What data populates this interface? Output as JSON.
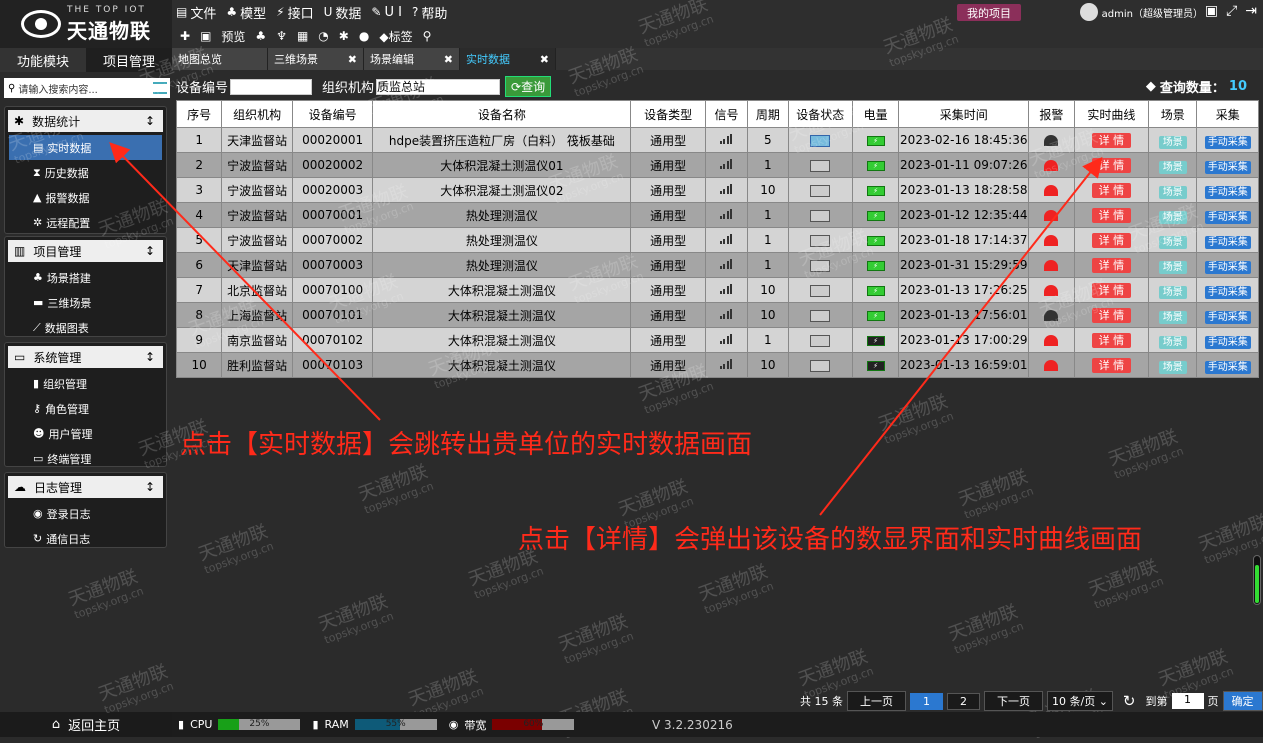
{
  "logo": {
    "top": "THE TOP IOT",
    "brand": "天通物联"
  },
  "menu": [
    {
      "icon": "file-icon",
      "label": "文件"
    },
    {
      "icon": "model-icon",
      "label": "模型"
    },
    {
      "icon": "plug-icon",
      "label": "接口"
    },
    {
      "icon": "magnet-icon",
      "label": "数据"
    },
    {
      "icon": "pencil-icon",
      "label": "U I"
    },
    {
      "icon": "help-icon",
      "label": "帮助"
    }
  ],
  "my_project": "我的项目",
  "user": "admin（超级管理员）",
  "toolbar": {
    "preview": "预览",
    "tag": "标签"
  },
  "sidebar_tabs": {
    "func": "功能模块",
    "proj": "项目管理"
  },
  "search_placeholder": "请输入搜索内容...",
  "groups": [
    {
      "title": "数据统计",
      "items": [
        "实时数据",
        "历史数据",
        "报警数据",
        "远程配置"
      ]
    },
    {
      "title": "项目管理",
      "items": [
        "场景搭建",
        "三维场景",
        "数据图表"
      ]
    },
    {
      "title": "系统管理",
      "items": [
        "组织管理",
        "角色管理",
        "用户管理",
        "终端管理"
      ]
    },
    {
      "title": "日志管理",
      "items": [
        "登录日志",
        "通信日志"
      ]
    }
  ],
  "home": "返回主页",
  "tabs": [
    "地图总览",
    "三维场景",
    "场景编辑",
    "实时数据"
  ],
  "filter": {
    "device_no_label": "设备编号",
    "org_label": "组织机构",
    "org_value": "质监总站",
    "query": "查询"
  },
  "count": {
    "label": "查询数量：",
    "value": "10"
  },
  "table": {
    "headers": [
      "序号",
      "组织机构",
      "设备编号",
      "设备名称",
      "设备类型",
      "信号",
      "周期",
      "设备状态",
      "电量",
      "采集时间",
      "报警",
      "实时曲线",
      "场景",
      "采集"
    ],
    "detail": "详 情",
    "scene": "场景",
    "collect": "手动采集",
    "rows": [
      [
        "1",
        "天津监督站",
        "00020001",
        "hdpe装置挤压造粒厂房（白料） 筏板基础",
        "通用型",
        "5",
        "2023-02-16 18:45:36"
      ],
      [
        "2",
        "宁波监督站",
        "00020002",
        "大体积混凝土测温仪01",
        "通用型",
        "1",
        "2023-01-11 09:07:26"
      ],
      [
        "3",
        "宁波监督站",
        "00020003",
        "大体积混凝土测温仪02",
        "通用型",
        "10",
        "2023-01-13 18:28:58"
      ],
      [
        "4",
        "宁波监督站",
        "00070001",
        "热处理测温仪",
        "通用型",
        "1",
        "2023-01-12 12:35:44"
      ],
      [
        "5",
        "宁波监督站",
        "00070002",
        "热处理测温仪",
        "通用型",
        "1",
        "2023-01-18 17:14:37"
      ],
      [
        "6",
        "天津监督站",
        "00070003",
        "热处理测温仪",
        "通用型",
        "1",
        "2023-01-31 15:29:59"
      ],
      [
        "7",
        "北京监督站",
        "00070100",
        "大体积混凝土测温仪",
        "通用型",
        "10",
        "2023-01-13 17:26:25"
      ],
      [
        "8",
        "上海监督站",
        "00070101",
        "大体积混凝土测温仪",
        "通用型",
        "10",
        "2023-01-13 17:56:01"
      ],
      [
        "9",
        "南京监督站",
        "00070102",
        "大体积混凝土测温仪",
        "通用型",
        "1",
        "2023-01-13 17:00:29"
      ],
      [
        "10",
        "胜利监督站",
        "00070103",
        "大体积混凝土测温仪",
        "通用型",
        "10",
        "2023-01-13 16:59:01"
      ]
    ]
  },
  "annotations": {
    "a1": "点击【实时数据】会跳转出贵单位的实时数据画面",
    "a2": "点击【详情】会弹出该设备的数显界面和实时曲线画面"
  },
  "pager": {
    "total": "共 15 条",
    "prev": "上一页",
    "p1": "1",
    "p2": "2",
    "next": "下一页",
    "size": "10 条/页",
    "goto": "到第",
    "page_val": "1",
    "page_unit": "页",
    "ok": "确定"
  },
  "status": {
    "cpu": "CPU",
    "cpu_val": "25%",
    "ram": "RAM",
    "ram_val": "55%",
    "bw": "带宽",
    "bw_val": "60%",
    "version": "V 3.2.230216"
  },
  "status_levels": {
    "cpu": 0.25,
    "ram": 0.55,
    "bw": 0.6
  },
  "colors": {
    "accent": "#2b78d0",
    "annotation": "#ff2a1a",
    "detail": "#e44444"
  },
  "watermark": {
    "cn": "天通物联",
    "en": "topsky.org.cn"
  }
}
